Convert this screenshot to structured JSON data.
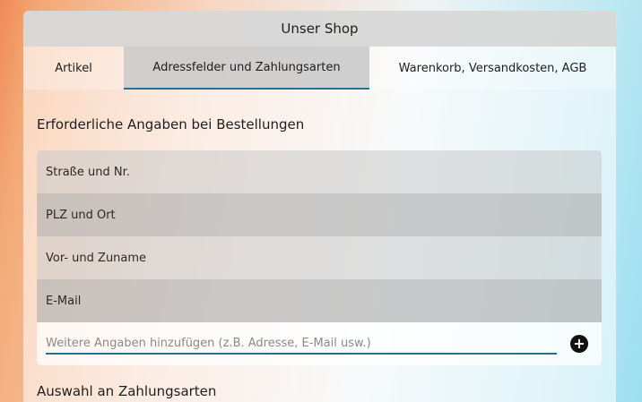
{
  "window": {
    "title": "Unser Shop"
  },
  "tabs": [
    {
      "label": "Artikel"
    },
    {
      "label": "Adressfelder und Zahlungsarten"
    },
    {
      "label": "Warenkorb, Versandkosten, AGB"
    }
  ],
  "required_section": {
    "title": "Erforderliche Angaben bei Bestellungen"
  },
  "fields": [
    {
      "label": "Straße und Nr."
    },
    {
      "label": "PLZ und Ort"
    },
    {
      "label": "Vor- und Zuname"
    },
    {
      "label": "E-Mail"
    }
  ],
  "add_field": {
    "placeholder": "Weitere Angaben hinzufügen (z.B. Adresse, E-Mail usw.)",
    "icon": "plus-circle-icon"
  },
  "payment_section": {
    "title": "Auswahl an Zahlungsarten"
  },
  "colors": {
    "accent": "#2a6f8f"
  }
}
